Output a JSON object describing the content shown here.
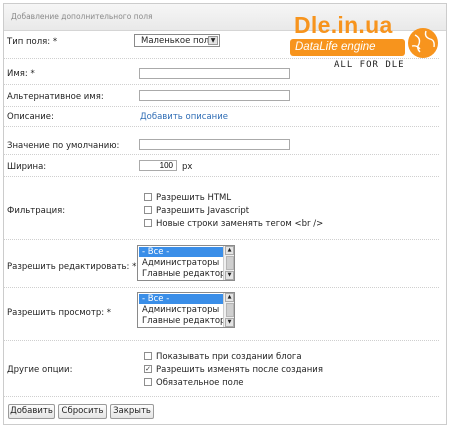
{
  "header": {
    "title": "Добавление дополнительного поля"
  },
  "brand": {
    "name": "Dle.in.ua",
    "engine": "DataLife engine",
    "tagline": "ALL FOR DLE"
  },
  "colors": {
    "accent": "#f7941d",
    "link": "#2f6db5",
    "selection": "#3a8ee8"
  },
  "fields": {
    "type": {
      "label": "Тип поля: *",
      "value": "Маленькое поле"
    },
    "name": {
      "label": "Имя: *",
      "value": ""
    },
    "alt_name": {
      "label": "Альтернативное имя:",
      "value": ""
    },
    "description": {
      "label": "Описание:",
      "link": "Добавить описание"
    },
    "default": {
      "label": "Значение по умолчанию:",
      "value": ""
    },
    "width": {
      "label": "Ширина:",
      "value": "100",
      "unit": "px"
    }
  },
  "filter": {
    "label": "Фильтрация:",
    "options": [
      {
        "label": "Разрешить HTML",
        "checked": false
      },
      {
        "label": "Разрешить Javascript",
        "checked": false
      },
      {
        "label": "Новые строки заменять тегом <br />",
        "checked": false
      }
    ]
  },
  "edit_perm": {
    "label": "Разрешить редактировать: *",
    "options": [
      "- Все -",
      "Администраторы",
      "Главные редакторы"
    ]
  },
  "view_perm": {
    "label": "Разрешить просмотр: *",
    "options": [
      "- Все -",
      "Администраторы",
      "Главные редакторы"
    ]
  },
  "other": {
    "label": "Другие опции:",
    "options": [
      {
        "label": "Показывать при создании блога",
        "checked": false
      },
      {
        "label": "Разрешить изменять после создания",
        "checked": true
      },
      {
        "label": "Обязательное поле",
        "checked": false
      }
    ]
  },
  "buttons": {
    "add": "Добавить",
    "reset": "Сбросить",
    "close": "Закрыть"
  }
}
